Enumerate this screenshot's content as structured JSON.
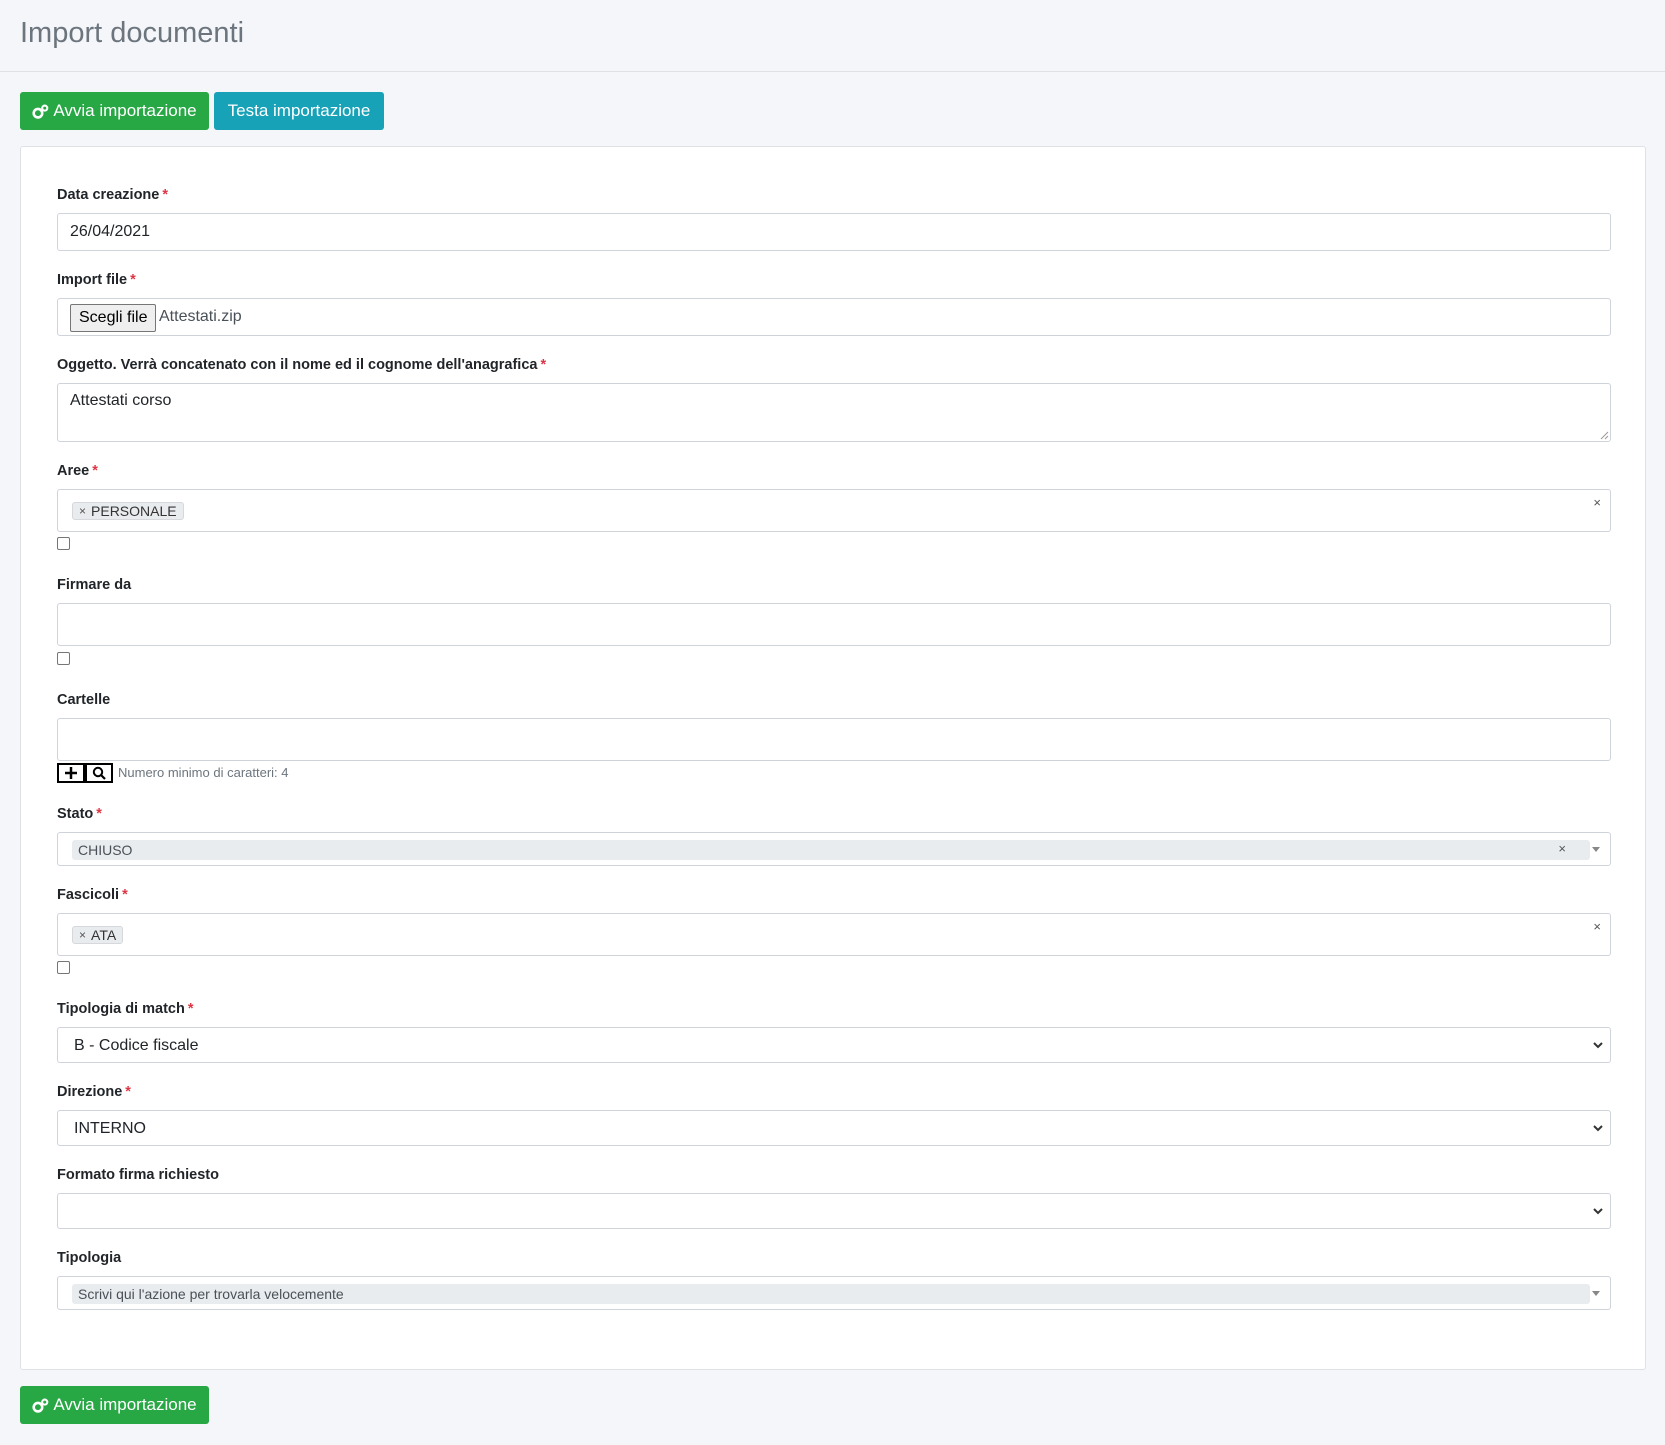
{
  "header": {
    "title": "Import documenti"
  },
  "toolbar": {
    "start_label": "Avvia importazione",
    "test_label": "Testa importazione"
  },
  "form": {
    "data_creazione": {
      "label": "Data creazione",
      "required_mark": "*",
      "value": "26/04/2021"
    },
    "import_file": {
      "label": "Import file",
      "required_mark": "*",
      "button_label": "Scegli file",
      "file_name": "Attestati.zip"
    },
    "oggetto": {
      "label": "Oggetto. Verrà concatenato con il nome ed il cognome dell'anagrafica",
      "required_mark": "*",
      "value": "Attestati corso"
    },
    "aree": {
      "label": "Aree",
      "required_mark": "*",
      "tags": [
        "PERSONALE"
      ],
      "tag_remove": "×",
      "clear": "×",
      "checked": false
    },
    "firmare_da": {
      "label": "Firmare da",
      "value": "",
      "checked": false
    },
    "cartelle": {
      "label": "Cartelle",
      "value": "",
      "hint": "Numero minimo di caratteri: 4",
      "add_icon": "plus-icon",
      "search_icon": "search-icon"
    },
    "stato": {
      "label": "Stato",
      "required_mark": "*",
      "value": "CHIUSO",
      "clear": "×"
    },
    "fascicoli": {
      "label": "Fascicoli",
      "required_mark": "*",
      "tags": [
        "ATA"
      ],
      "tag_remove": "×",
      "clear": "×",
      "checked": false
    },
    "tipologia_match": {
      "label": "Tipologia di match",
      "required_mark": "*",
      "value": "B - Codice fiscale"
    },
    "direzione": {
      "label": "Direzione",
      "required_mark": "*",
      "value": "INTERNO"
    },
    "formato_firma": {
      "label": "Formato firma richiesto",
      "value": ""
    },
    "tipologia": {
      "label": "Tipologia",
      "placeholder": "Scrivi qui l'azione per trovarla velocemente"
    }
  },
  "footer": {
    "start_label": "Avvia importazione"
  },
  "colors": {
    "green": "#28a745",
    "teal": "#17a2b8",
    "required": "#dc3545",
    "background": "#f4f6f9"
  }
}
